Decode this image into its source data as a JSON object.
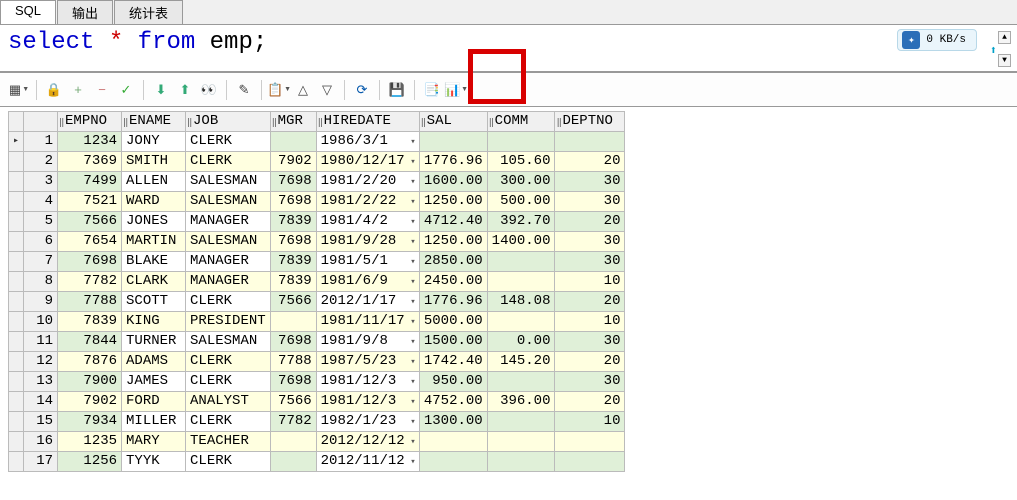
{
  "tabs": [
    "SQL",
    "输出",
    "统计表"
  ],
  "sql": {
    "q": "select * from emp;"
  },
  "net": {
    "speed": "0 KB/s"
  },
  "toolbar_icons": {
    "grid": "▦",
    "lock": "🔒",
    "add": "+",
    "del": "−",
    "commit": "✓",
    "down": "⬇",
    "up": "⬆",
    "find": "👀",
    "edit": "✎",
    "copy": "📋",
    "up2": "△",
    "dn2": "▽",
    "refresh": "⟳",
    "save": "💾",
    "filter": "📑",
    "chart": "📊"
  },
  "cols": [
    "EMPNO",
    "ENAME",
    "JOB",
    "MGR",
    "HIREDATE",
    "SAL",
    "COMM",
    "DEPTNO"
  ],
  "rows": [
    {
      "n": 1,
      "empno": 1234,
      "ename": "JONY",
      "job": "CLERK",
      "mgr": "",
      "hiredate": "1986/3/1",
      "sal": "",
      "comm": "",
      "deptno": ""
    },
    {
      "n": 2,
      "empno": 7369,
      "ename": "SMITH",
      "job": "CLERK",
      "mgr": 7902,
      "hiredate": "1980/12/17",
      "sal": "1776.96",
      "comm": "105.60",
      "deptno": 20
    },
    {
      "n": 3,
      "empno": 7499,
      "ename": "ALLEN",
      "job": "SALESMAN",
      "mgr": 7698,
      "hiredate": "1981/2/20",
      "sal": "1600.00",
      "comm": "300.00",
      "deptno": 30
    },
    {
      "n": 4,
      "empno": 7521,
      "ename": "WARD",
      "job": "SALESMAN",
      "mgr": 7698,
      "hiredate": "1981/2/22",
      "sal": "1250.00",
      "comm": "500.00",
      "deptno": 30
    },
    {
      "n": 5,
      "empno": 7566,
      "ename": "JONES",
      "job": "MANAGER",
      "mgr": 7839,
      "hiredate": "1981/4/2",
      "sal": "4712.40",
      "comm": "392.70",
      "deptno": 20
    },
    {
      "n": 6,
      "empno": 7654,
      "ename": "MARTIN",
      "job": "SALESMAN",
      "mgr": 7698,
      "hiredate": "1981/9/28",
      "sal": "1250.00",
      "comm": "1400.00",
      "deptno": 30
    },
    {
      "n": 7,
      "empno": 7698,
      "ename": "BLAKE",
      "job": "MANAGER",
      "mgr": 7839,
      "hiredate": "1981/5/1",
      "sal": "2850.00",
      "comm": "",
      "deptno": 30
    },
    {
      "n": 8,
      "empno": 7782,
      "ename": "CLARK",
      "job": "MANAGER",
      "mgr": 7839,
      "hiredate": "1981/6/9",
      "sal": "2450.00",
      "comm": "",
      "deptno": 10
    },
    {
      "n": 9,
      "empno": 7788,
      "ename": "SCOTT",
      "job": "CLERK",
      "mgr": 7566,
      "hiredate": "2012/1/17",
      "sal": "1776.96",
      "comm": "148.08",
      "deptno": 20
    },
    {
      "n": 10,
      "empno": 7839,
      "ename": "KING",
      "job": "PRESIDENT",
      "mgr": "",
      "hiredate": "1981/11/17",
      "sal": "5000.00",
      "comm": "",
      "deptno": 10
    },
    {
      "n": 11,
      "empno": 7844,
      "ename": "TURNER",
      "job": "SALESMAN",
      "mgr": 7698,
      "hiredate": "1981/9/8",
      "sal": "1500.00",
      "comm": "0.00",
      "deptno": 30
    },
    {
      "n": 12,
      "empno": 7876,
      "ename": "ADAMS",
      "job": "CLERK",
      "mgr": 7788,
      "hiredate": "1987/5/23",
      "sal": "1742.40",
      "comm": "145.20",
      "deptno": 20
    },
    {
      "n": 13,
      "empno": 7900,
      "ename": "JAMES",
      "job": "CLERK",
      "mgr": 7698,
      "hiredate": "1981/12/3",
      "sal": "950.00",
      "comm": "",
      "deptno": 30
    },
    {
      "n": 14,
      "empno": 7902,
      "ename": "FORD",
      "job": "ANALYST",
      "mgr": 7566,
      "hiredate": "1981/12/3",
      "sal": "4752.00",
      "comm": "396.00",
      "deptno": 20
    },
    {
      "n": 15,
      "empno": 7934,
      "ename": "MILLER",
      "job": "CLERK",
      "mgr": 7782,
      "hiredate": "1982/1/23",
      "sal": "1300.00",
      "comm": "",
      "deptno": 10
    },
    {
      "n": 16,
      "empno": 1235,
      "ename": "MARY",
      "job": "TEACHER",
      "mgr": "",
      "hiredate": "2012/12/12",
      "sal": "",
      "comm": "",
      "deptno": ""
    },
    {
      "n": 17,
      "empno": 1256,
      "ename": "TYYK",
      "job": "CLERK",
      "mgr": "",
      "hiredate": "2012/11/12",
      "sal": "",
      "comm": "",
      "deptno": ""
    }
  ]
}
